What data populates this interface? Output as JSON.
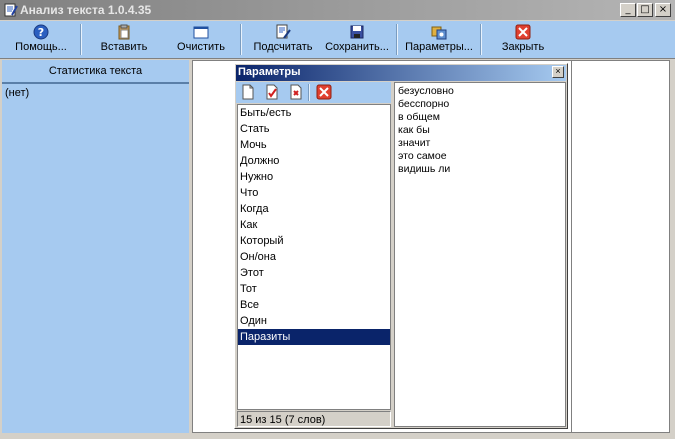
{
  "window": {
    "title": "Анализ текста 1.0.4.35",
    "controls": {
      "minimize": "_",
      "maximize": "□",
      "close": "×"
    }
  },
  "toolbar": {
    "help": {
      "label": "Помощь...",
      "icon": "help-icon"
    },
    "paste": {
      "label": "Вставить",
      "icon": "clipboard-icon"
    },
    "clear": {
      "label": "Очистить",
      "icon": "blank-window-icon"
    },
    "count": {
      "label": "Подсчитать",
      "icon": "calculate-icon"
    },
    "save": {
      "label": "Сохранить...",
      "icon": "floppy-disk-icon"
    },
    "params": {
      "label": "Параметры...",
      "icon": "settings-icon"
    },
    "close": {
      "label": "Закрыть",
      "icon": "close-icon"
    }
  },
  "left_panel": {
    "header": "Статистика текста",
    "empty_text": "(нет)"
  },
  "dialog": {
    "title": "Параметры",
    "close": "×",
    "tools": [
      "new-page-icon",
      "check-page-icon",
      "delete-page-icon",
      "close-red-icon"
    ],
    "words": [
      "Быть/есть",
      "Стать",
      "Мочь",
      "Должно",
      "Нужно",
      "Что",
      "Когда",
      "Как",
      "Который",
      "Он/она",
      "Этот",
      "Тот",
      "Все",
      "Один",
      "Паразиты"
    ],
    "selected_index": 14,
    "status": "15 из 15 (7 слов)",
    "contents": [
      "безусловно",
      "бесспорно",
      "в общем",
      "как бы",
      "значит",
      "это самое",
      "видишь ли"
    ]
  }
}
